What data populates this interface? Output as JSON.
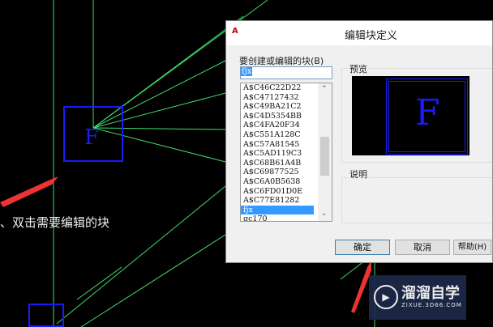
{
  "instruction_text": "、双击需要编辑的块",
  "dialog": {
    "title": "编辑块定义",
    "block_label": "要创建或编辑的块(B)",
    "block_input_value": "fjx",
    "block_list": [
      "A$C46C22D22",
      "A$C47127432",
      "A$C49BA21C2",
      "A$C4D5354BB",
      "A$C4FA20F34",
      "A$C551A128C",
      "A$C57A81545",
      "A$C5AD119C3",
      "A$C68B61A4B",
      "A$C69877525",
      "A$C6A0B5638",
      "A$C6FD01D0E",
      "A$C77E81282",
      "fjx",
      "gc170"
    ],
    "selected_block": "fjx",
    "preview_label": "预览",
    "preview_letter": "F",
    "description_label": "说明",
    "ok_label": "确定",
    "cancel_label": "取消",
    "help_label": "帮助(H)"
  },
  "canvas": {
    "block_letter": "F"
  },
  "watermark": {
    "name": "溜溜自学",
    "url": "ZIXUE.3D66.COM"
  }
}
